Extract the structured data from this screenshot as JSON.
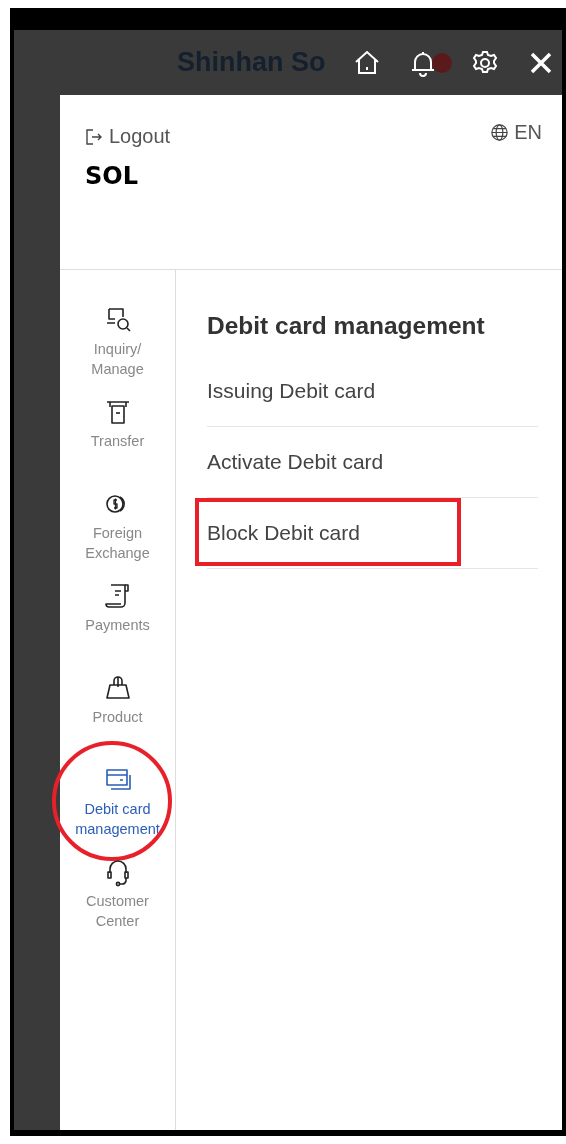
{
  "background": {
    "logo": "Shinhan So",
    "notification_badge": true
  },
  "panel": {
    "logout": "Logout",
    "language": "EN",
    "title": "SOL"
  },
  "sidebar": {
    "items": [
      {
        "label": "Inquiry/ Manage",
        "kind": "inquiry",
        "selected": false,
        "annotated": false
      },
      {
        "label": "Transfer",
        "kind": "transfer",
        "selected": false,
        "annotated": false
      },
      {
        "label": "Foreign Exchange",
        "kind": "exchange",
        "selected": false,
        "annotated": false
      },
      {
        "label": "Payments",
        "kind": "payments",
        "selected": false,
        "annotated": false
      },
      {
        "label": "Product",
        "kind": "product",
        "selected": false,
        "annotated": false
      },
      {
        "label": "Debit card management",
        "kind": "card",
        "selected": true,
        "annotated": true
      },
      {
        "label": "Customer Center",
        "kind": "support",
        "selected": false,
        "annotated": false
      }
    ]
  },
  "content": {
    "heading": "Debit card management",
    "items": [
      {
        "label": "Issuing Debit card",
        "annotated": false
      },
      {
        "label": "Activate Debit card",
        "annotated": false
      },
      {
        "label": "Block Debit card",
        "annotated": true
      }
    ]
  }
}
